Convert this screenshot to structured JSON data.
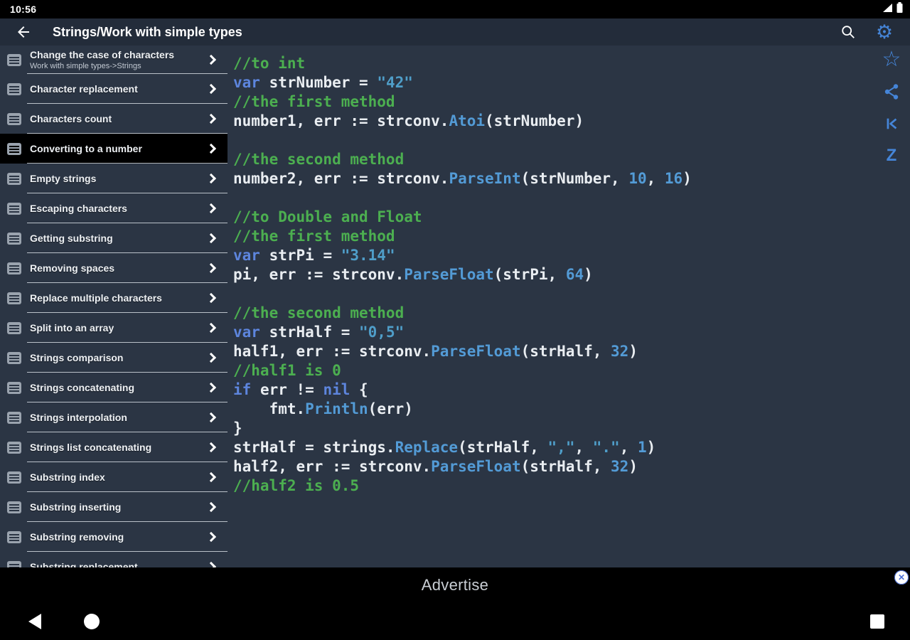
{
  "colors": {
    "accent": "#4585d8",
    "bg": "#2b3544",
    "toolbar_bg": "#232c3a",
    "comment": "#4caf50",
    "keyword": "#5d85dd",
    "string": "#4f9ec9",
    "function": "#539bd6",
    "number": "#539bd6"
  },
  "status_bar": {
    "time": "10:56"
  },
  "toolbar": {
    "title": "Strings/Work with simple types",
    "settings_glyph": "⚙"
  },
  "sidebar": {
    "items": [
      {
        "label": "Change the case of characters",
        "subtitle": "Work with simple types->Strings",
        "selected": false
      },
      {
        "label": "Character replacement",
        "selected": false
      },
      {
        "label": "Characters count",
        "selected": false
      },
      {
        "label": "Converting to a number",
        "selected": true
      },
      {
        "label": "Empty strings",
        "selected": false
      },
      {
        "label": "Escaping characters",
        "selected": false
      },
      {
        "label": "Getting substring",
        "selected": false
      },
      {
        "label": "Removing spaces",
        "selected": false
      },
      {
        "label": "Replace multiple characters",
        "selected": false
      },
      {
        "label": "Split into an array",
        "selected": false
      },
      {
        "label": "Strings comparison",
        "selected": false
      },
      {
        "label": "Strings concatenating",
        "selected": false
      },
      {
        "label": "Strings interpolation",
        "selected": false
      },
      {
        "label": "Strings list concatenating",
        "selected": false
      },
      {
        "label": "Substring index",
        "selected": false
      },
      {
        "label": "Substring inserting",
        "selected": false
      },
      {
        "label": "Substring removing",
        "selected": false
      },
      {
        "label": "Substring replacement",
        "selected": false
      }
    ]
  },
  "code": {
    "lines": [
      {
        "tokens": [
          {
            "t": "//to int",
            "c": "comment"
          }
        ]
      },
      {
        "tokens": [
          {
            "t": "var",
            "c": "keyword"
          },
          {
            "t": " strNumber = ",
            "c": "plain"
          },
          {
            "t": "\"42\"",
            "c": "string"
          }
        ]
      },
      {
        "tokens": [
          {
            "t": "//the first method",
            "c": "comment"
          }
        ]
      },
      {
        "tokens": [
          {
            "t": "number1, err := strconv.",
            "c": "plain"
          },
          {
            "t": "Atoi",
            "c": "func"
          },
          {
            "t": "(strNumber)",
            "c": "plain"
          }
        ]
      },
      {
        "tokens": []
      },
      {
        "tokens": [
          {
            "t": "//the second method",
            "c": "comment"
          }
        ]
      },
      {
        "tokens": [
          {
            "t": "number2, err := strconv.",
            "c": "plain"
          },
          {
            "t": "ParseInt",
            "c": "func"
          },
          {
            "t": "(strNumber, ",
            "c": "plain"
          },
          {
            "t": "10",
            "c": "num"
          },
          {
            "t": ", ",
            "c": "plain"
          },
          {
            "t": "16",
            "c": "num"
          },
          {
            "t": ")",
            "c": "plain"
          }
        ]
      },
      {
        "tokens": []
      },
      {
        "tokens": [
          {
            "t": "//to Double and Float",
            "c": "comment"
          }
        ]
      },
      {
        "tokens": [
          {
            "t": "//the first method",
            "c": "comment"
          }
        ]
      },
      {
        "tokens": [
          {
            "t": "var",
            "c": "keyword"
          },
          {
            "t": " strPi = ",
            "c": "plain"
          },
          {
            "t": "\"3.14\"",
            "c": "string"
          }
        ]
      },
      {
        "tokens": [
          {
            "t": "pi, err := strconv.",
            "c": "plain"
          },
          {
            "t": "ParseFloat",
            "c": "func"
          },
          {
            "t": "(strPi, ",
            "c": "plain"
          },
          {
            "t": "64",
            "c": "num"
          },
          {
            "t": ")",
            "c": "plain"
          }
        ]
      },
      {
        "tokens": []
      },
      {
        "tokens": [
          {
            "t": "//the second method",
            "c": "comment"
          }
        ]
      },
      {
        "tokens": [
          {
            "t": "var",
            "c": "keyword"
          },
          {
            "t": " strHalf = ",
            "c": "plain"
          },
          {
            "t": "\"0,5\"",
            "c": "string"
          }
        ]
      },
      {
        "tokens": [
          {
            "t": "half1, err := strconv.",
            "c": "plain"
          },
          {
            "t": "ParseFloat",
            "c": "func"
          },
          {
            "t": "(strHalf, ",
            "c": "plain"
          },
          {
            "t": "32",
            "c": "num"
          },
          {
            "t": ")",
            "c": "plain"
          }
        ]
      },
      {
        "tokens": [
          {
            "t": "//half1 is 0",
            "c": "comment"
          }
        ]
      },
      {
        "tokens": [
          {
            "t": "if",
            "c": "keyword"
          },
          {
            "t": " err != ",
            "c": "plain"
          },
          {
            "t": "nil",
            "c": "keyword"
          },
          {
            "t": " {",
            "c": "plain"
          }
        ]
      },
      {
        "tokens": [
          {
            "t": "    fmt.",
            "c": "plain"
          },
          {
            "t": "Println",
            "c": "func"
          },
          {
            "t": "(err)",
            "c": "plain"
          }
        ]
      },
      {
        "tokens": [
          {
            "t": "}",
            "c": "plain"
          }
        ]
      },
      {
        "tokens": [
          {
            "t": "strHalf = strings.",
            "c": "plain"
          },
          {
            "t": "Replace",
            "c": "func"
          },
          {
            "t": "(strHalf, ",
            "c": "plain"
          },
          {
            "t": "\",\"",
            "c": "string"
          },
          {
            "t": ", ",
            "c": "plain"
          },
          {
            "t": "\".\"",
            "c": "string"
          },
          {
            "t": ", ",
            "c": "plain"
          },
          {
            "t": "1",
            "c": "num"
          },
          {
            "t": ")",
            "c": "plain"
          }
        ]
      },
      {
        "tokens": [
          {
            "t": "half2, err := strconv.",
            "c": "plain"
          },
          {
            "t": "ParseFloat",
            "c": "func"
          },
          {
            "t": "(strHalf, ",
            "c": "plain"
          },
          {
            "t": "32",
            "c": "num"
          },
          {
            "t": ")",
            "c": "plain"
          }
        ]
      },
      {
        "tokens": [
          {
            "t": "//half2 is 0.5",
            "c": "comment"
          }
        ]
      }
    ]
  },
  "side_panel_icons": [
    {
      "name": "star-icon",
      "glyph": "☆"
    },
    {
      "name": "share-icon"
    },
    {
      "name": "skip-to-start-icon"
    },
    {
      "name": "letter-z-icon",
      "glyph": "Z"
    }
  ],
  "ad_bar": {
    "label": "Advertise",
    "close_glyph": "✕"
  }
}
